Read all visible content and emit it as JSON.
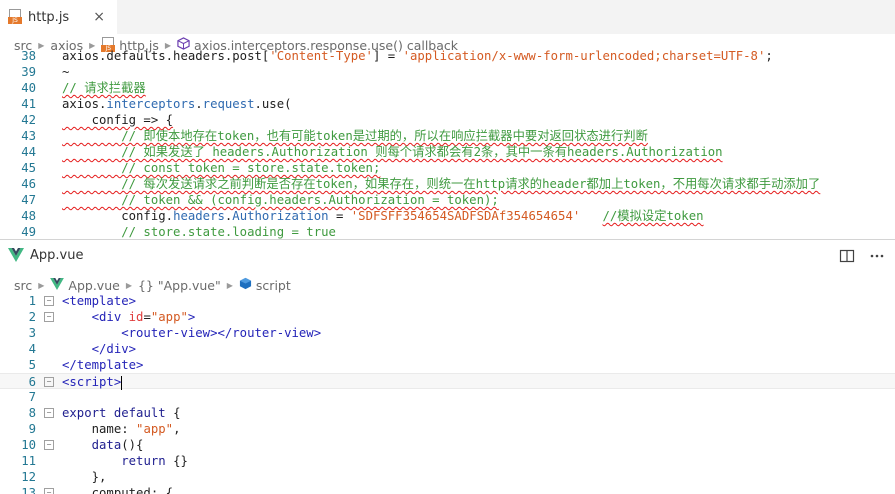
{
  "top_editor": {
    "tab": {
      "icon": "js-file-icon",
      "label": "http.js",
      "close": "×"
    },
    "breadcrumb": [
      {
        "label": "src",
        "icon": null
      },
      {
        "label": "axios",
        "icon": null
      },
      {
        "label": "http.js",
        "icon": "js-file-icon"
      },
      {
        "label": "axios.interceptors.response.use() callback",
        "icon": "method-icon"
      }
    ],
    "lines": [
      {
        "num": "38",
        "tokens": [
          {
            "t": "axios.defaults.headers.post[",
            "c": "c-plain"
          },
          {
            "t": "'Content-Type'",
            "c": "c-str"
          },
          {
            "t": "] = ",
            "c": "c-plain"
          },
          {
            "t": "'application/x-www-form-urlencoded;charset=UTF-8'",
            "c": "c-str"
          },
          {
            "t": ";",
            "c": "c-plain"
          }
        ]
      },
      {
        "num": "39",
        "tokens": [
          {
            "t": "~",
            "c": "c-plain"
          }
        ]
      },
      {
        "num": "40",
        "tokens": [
          {
            "t": "// 请求拦截器",
            "c": "c-comment",
            "sq": true
          }
        ]
      },
      {
        "num": "41",
        "tokens": [
          {
            "t": "axios.",
            "c": "c-plain"
          },
          {
            "t": "interceptors",
            "c": "c-prop"
          },
          {
            "t": ".",
            "c": "c-plain"
          },
          {
            "t": "request",
            "c": "c-prop"
          },
          {
            "t": ".use(",
            "c": "c-plain"
          }
        ]
      },
      {
        "num": "42",
        "tokens": [
          {
            "t": "    config => {",
            "c": "c-plain",
            "sq": true
          }
        ]
      },
      {
        "num": "43",
        "tokens": [
          {
            "t": "        // 即使本地存在token，也有可能token是过期的，所以在响应拦截器中要对返回状态进行判断",
            "c": "c-comment",
            "sq": true
          }
        ]
      },
      {
        "num": "44",
        "tokens": [
          {
            "t": "        // 如果发送了 headers.Authorization 则每个请求都会有2条，其中一条有headers.Authorization",
            "c": "c-comment",
            "sq": true
          }
        ]
      },
      {
        "num": "45",
        "tokens": [
          {
            "t": "        // const token = store.state.token;",
            "c": "c-comment",
            "sq": true
          }
        ]
      },
      {
        "num": "46",
        "tokens": [
          {
            "t": "        // 每次发送请求之前判断是否存在token，如果存在，则统一在http请求的header都加上token，不用每次请求都手动添加了",
            "c": "c-comment",
            "sq": true
          }
        ]
      },
      {
        "num": "47",
        "tokens": [
          {
            "t": "        // token && (config.headers.Authorization = token);",
            "c": "c-comment",
            "sq": true
          }
        ]
      },
      {
        "num": "48",
        "tokens": [
          {
            "t": "        config.",
            "c": "c-plain"
          },
          {
            "t": "headers",
            "c": "c-prop"
          },
          {
            "t": ".",
            "c": "c-plain"
          },
          {
            "t": "Authorization",
            "c": "c-prop"
          },
          {
            "t": " = ",
            "c": "c-plain"
          },
          {
            "t": "'SDFSFF354654SADFSDAf354654654'",
            "c": "c-str"
          },
          {
            "t": "   ",
            "c": "c-plain"
          },
          {
            "t": "//模拟设定token",
            "c": "c-comment",
            "sq": true
          }
        ]
      },
      {
        "num": "49",
        "tokens": [
          {
            "t": "        // store.state.loading = true",
            "c": "c-comment"
          }
        ]
      }
    ]
  },
  "bottom_editor": {
    "tab": {
      "icon": "vue-file-icon",
      "label": "App.vue"
    },
    "breadcrumb": [
      {
        "label": "src",
        "icon": null
      },
      {
        "label": "App.vue",
        "icon": "vue-file-icon"
      },
      {
        "label": "{} \"App.vue\"",
        "icon": null
      },
      {
        "label": "script",
        "icon": "module-icon"
      }
    ],
    "lines": [
      {
        "num": "1",
        "fold": "−",
        "tokens": [
          {
            "t": "<template>",
            "c": "c-tag"
          }
        ]
      },
      {
        "num": "2",
        "fold": "−",
        "tokens": [
          {
            "t": "    ",
            "c": "c-plain"
          },
          {
            "t": "<div ",
            "c": "c-tag"
          },
          {
            "t": "id",
            "c": "c-attr"
          },
          {
            "t": "=",
            "c": "c-plain"
          },
          {
            "t": "\"app\"",
            "c": "c-str"
          },
          {
            "t": ">",
            "c": "c-tag"
          }
        ]
      },
      {
        "num": "3",
        "tokens": [
          {
            "t": "        <router-view></router-view>",
            "c": "c-tag"
          }
        ]
      },
      {
        "num": "4",
        "tokens": [
          {
            "t": "    </div>",
            "c": "c-tag"
          }
        ]
      },
      {
        "num": "5",
        "tokens": [
          {
            "t": "</template>",
            "c": "c-tag"
          }
        ]
      },
      {
        "num": "6",
        "fold": "−",
        "current": true,
        "caret": true,
        "tokens": [
          {
            "t": "<script>",
            "c": "c-tag"
          }
        ]
      },
      {
        "num": "7",
        "tokens": []
      },
      {
        "num": "8",
        "fold": "−",
        "tokens": [
          {
            "t": "export ",
            "c": "c-kw"
          },
          {
            "t": "default ",
            "c": "c-kw"
          },
          {
            "t": "{",
            "c": "c-plain"
          }
        ]
      },
      {
        "num": "9",
        "tokens": [
          {
            "t": "    name: ",
            "c": "c-plain"
          },
          {
            "t": "\"app\"",
            "c": "c-str"
          },
          {
            "t": ",",
            "c": "c-plain"
          }
        ]
      },
      {
        "num": "10",
        "fold": "−",
        "tokens": [
          {
            "t": "    data",
            "c": "c-kw"
          },
          {
            "t": "(){",
            "c": "c-plain"
          }
        ]
      },
      {
        "num": "11",
        "tokens": [
          {
            "t": "        ",
            "c": "c-plain"
          },
          {
            "t": "return ",
            "c": "c-kw"
          },
          {
            "t": "{}",
            "c": "c-plain"
          }
        ]
      },
      {
        "num": "12",
        "tokens": [
          {
            "t": "    },",
            "c": "c-plain"
          }
        ]
      },
      {
        "num": "13",
        "fold": "−",
        "tokens": [
          {
            "t": "    computed: {",
            "c": "c-plain"
          }
        ]
      }
    ]
  }
}
